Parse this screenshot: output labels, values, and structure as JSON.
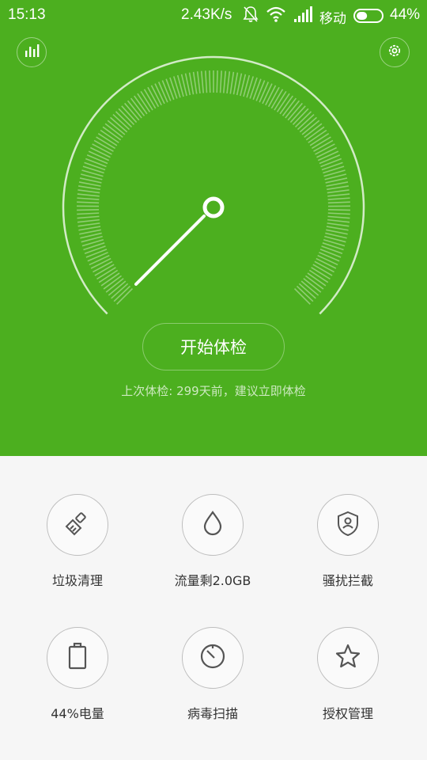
{
  "status_bar": {
    "time": "15:13",
    "speed": "2.43K/s",
    "carrier": "移动",
    "battery": "44%",
    "battery_level": 0.44,
    "icons": [
      "bell-off-icon",
      "wifi-icon",
      "signal-icon",
      "battery-icon"
    ]
  },
  "header": {
    "left_icon": "bar-chart-icon",
    "right_icon": "gear-icon",
    "background": "#4caf1f"
  },
  "gauge": {
    "needle_icon": "speedometer-needle"
  },
  "main": {
    "start_button": "开始体检",
    "last_check": "上次体检: 299天前，建议立即体检"
  },
  "tools": [
    {
      "label": "垃圾清理",
      "icon": "broom-icon"
    },
    {
      "label": "流量剩2.0GB",
      "icon": "drop-icon"
    },
    {
      "label": "骚扰拦截",
      "icon": "shield-user-icon"
    },
    {
      "label": "44%电量",
      "icon": "battery-outline-icon"
    },
    {
      "label": "病毒扫描",
      "icon": "scan-dial-icon"
    },
    {
      "label": "授权管理",
      "icon": "star-icon"
    }
  ]
}
